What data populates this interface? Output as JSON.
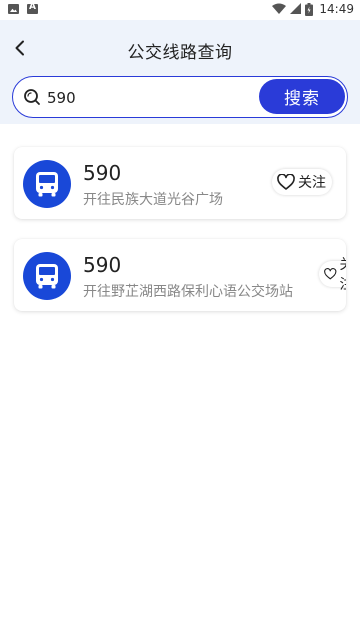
{
  "status": {
    "time": "14:49"
  },
  "header": {
    "title": "公交线路查询"
  },
  "search": {
    "value": "590",
    "button_label": "搜索"
  },
  "routes": [
    {
      "number": "590",
      "destination": "开往民族大道光谷广场",
      "follow_label": "关注"
    },
    {
      "number": "590",
      "destination": "开往野芷湖西路保利心语公交场站",
      "follow_label": "关注"
    }
  ],
  "colors": {
    "accent": "#2a3bd8",
    "bus_icon_bg": "#1948d8",
    "header_bg": "#eef3fb"
  }
}
